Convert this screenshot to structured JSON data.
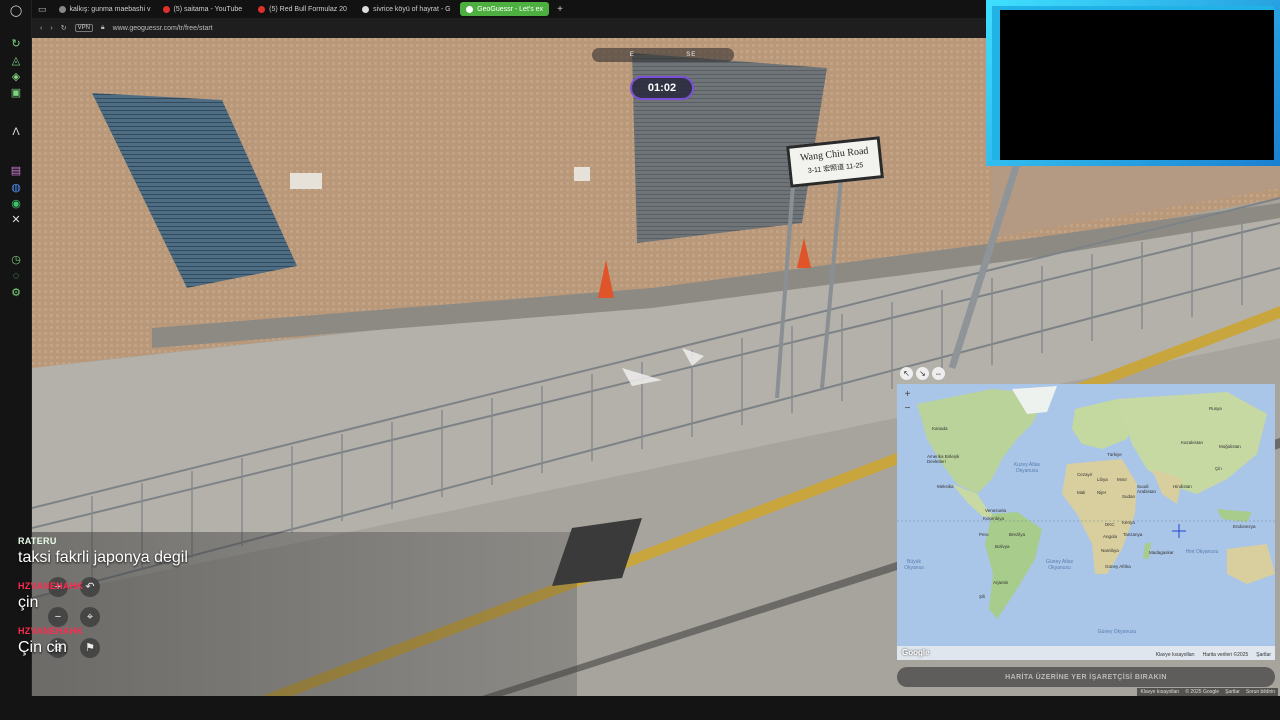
{
  "tabs": [
    {
      "label": "kalkış: gunma maebashi v",
      "color": "#888888",
      "active": false
    },
    {
      "label": "(5) saitama - YouTube",
      "color": "#e0302a",
      "active": false
    },
    {
      "label": "(5) Red Bull Formulaz 20",
      "color": "#e0302a",
      "active": false
    },
    {
      "label": "sivrice köyü of hayrat - G",
      "color": "#dddddd",
      "active": false
    },
    {
      "label": "GeoGuessr - Let's ex",
      "color": "#ffffff",
      "active": true
    }
  ],
  "address": {
    "vpn": "VPN",
    "url": "www.geoguessr.com/tr/free/start"
  },
  "compass": {
    "e": "E",
    "se": "SE"
  },
  "timer": "01:02",
  "sign": {
    "line1": "Wang Chiu Road",
    "line2": "3-11 宏照道 11-25"
  },
  "chat": [
    {
      "user": "RATERU",
      "message": "taksi fakrli japonya degil",
      "user_color": "#e8ffe8"
    },
    {
      "user": "HZVANEHAHK",
      "message": "çin",
      "user_color": "#ff2a4f"
    },
    {
      "user": "HZVANEHAHK",
      "message": "Çin cin",
      "user_color": "#ff2a4f"
    }
  ],
  "map": {
    "labels": [
      {
        "t": "Rusya"
      },
      {
        "t": "Kanada"
      },
      {
        "t": "Kazakistan"
      },
      {
        "t": "Moğolistan"
      },
      {
        "t": "Amerika Birleşik Devletleri"
      },
      {
        "t": "Kuzey Atlas Okyanusu"
      },
      {
        "t": "Türkiye"
      },
      {
        "t": "Çin"
      },
      {
        "t": "Cezayir"
      },
      {
        "t": "Libya"
      },
      {
        "t": "Mısır"
      },
      {
        "t": "Suudi Arabistan"
      },
      {
        "t": "Hindistan"
      },
      {
        "t": "Meksika"
      },
      {
        "t": "Mali"
      },
      {
        "t": "Nijer"
      },
      {
        "t": "Sudan"
      },
      {
        "t": "Venezuela"
      },
      {
        "t": "Kolombiya"
      },
      {
        "t": "Peru"
      },
      {
        "t": "Brezilya"
      },
      {
        "t": "Bolivya"
      },
      {
        "t": "DKC"
      },
      {
        "t": "Kenya"
      },
      {
        "t": "Angola"
      },
      {
        "t": "Tanzanya"
      },
      {
        "t": "Namibya"
      },
      {
        "t": "Güney Afrika"
      },
      {
        "t": "Arjantin"
      },
      {
        "t": "Madagaskar"
      },
      {
        "t": "Endonezya"
      },
      {
        "t": "Şili"
      }
    ],
    "oceans": [
      {
        "t": "Güney Atlas Okyanusu"
      },
      {
        "t": "Hint Okyanusu"
      },
      {
        "t": "Güney Okyanusu"
      },
      {
        "t": "Büyük Okyanus"
      }
    ],
    "google": "Google",
    "attribution": [
      "Klavye kısayolları",
      "Harita verileri ©2025",
      "Şartlar"
    ]
  },
  "guess_button": "HARİTA ÜZERİNE YER İŞARETÇİSİ BIRAKIN",
  "footer_links": [
    "Klavye kısayolları",
    "© 2025 Google",
    "Şartlar",
    "Sorun bildirin"
  ]
}
